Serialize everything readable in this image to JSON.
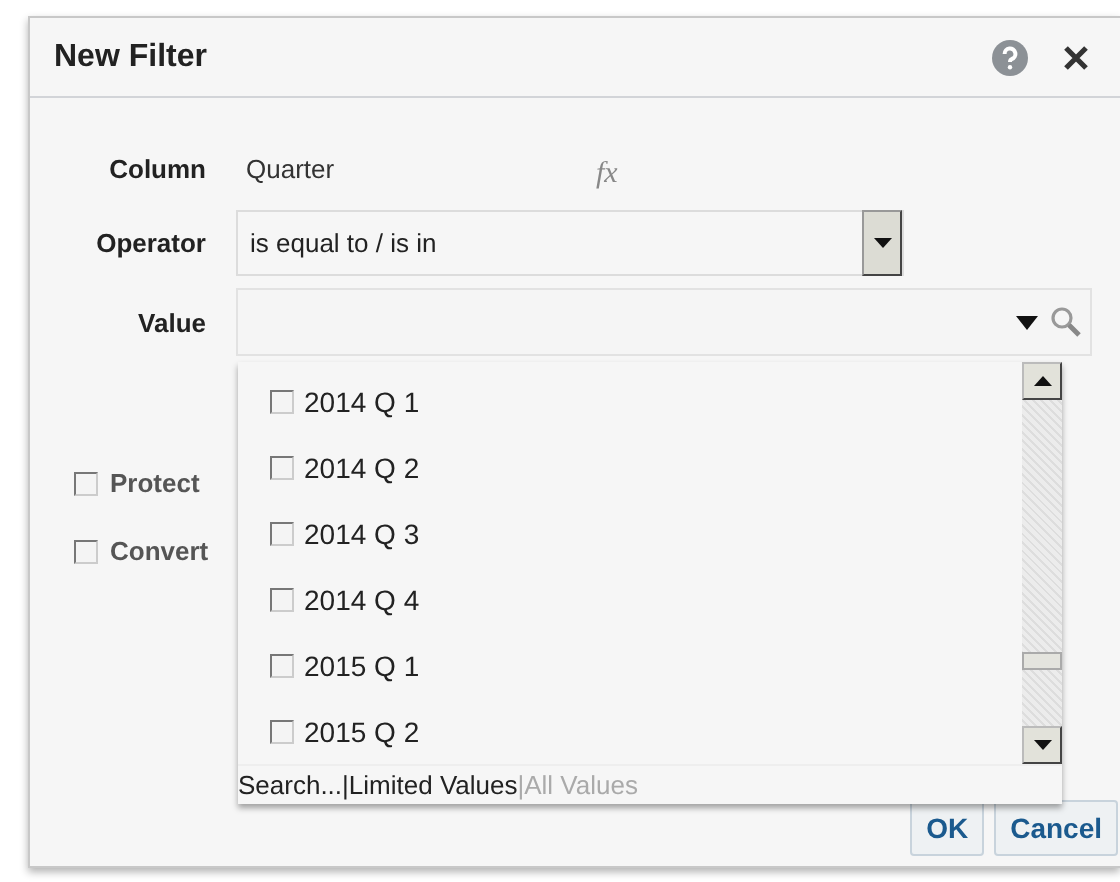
{
  "dialog": {
    "title": "New Filter"
  },
  "fields": [
    {
      "label": "Column",
      "kind": "text",
      "value": "Quarter",
      "formula": "fx"
    },
    {
      "label": "Operator",
      "kind": "select",
      "value": "is equal to / is in"
    },
    {
      "label": "Value",
      "kind": "combo"
    }
  ],
  "options": [
    {
      "label": "Protect",
      "checked": false
    },
    {
      "label": "Convert",
      "checked": false
    }
  ],
  "dropdown": {
    "items": [
      {
        "label": "2014 Q 1",
        "checked": false
      },
      {
        "label": "2014 Q 2",
        "checked": false
      },
      {
        "label": "2014 Q 3",
        "checked": false
      },
      {
        "label": "2014 Q 4",
        "checked": false
      },
      {
        "label": "2015 Q 1",
        "checked": false
      },
      {
        "label": "2015 Q 2",
        "checked": false
      }
    ],
    "separator": "|",
    "links": [
      {
        "label": "Search...",
        "disabled": false
      },
      {
        "label": "Limited Values",
        "disabled": false
      },
      {
        "label": "All Values",
        "disabled": true
      }
    ]
  },
  "buttons": [
    "OK",
    "Cancel"
  ]
}
